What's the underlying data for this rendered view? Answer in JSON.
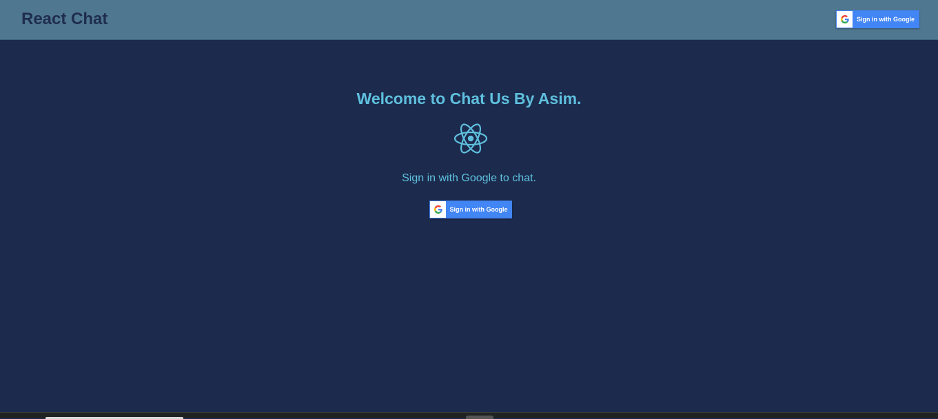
{
  "app": {
    "brand": "React Chat"
  },
  "header": {
    "signin_label": "Sign in with Google"
  },
  "main": {
    "welcome": "Welcome to Chat Us By Asim.",
    "subtitle": "Sign in with Google to chat.",
    "signin_label": "Sign in with Google",
    "logo_icon": "react-logo-icon"
  },
  "colors": {
    "navbar": "#4f778f",
    "background": "#1c2b4d",
    "accent": "#5fc0de",
    "google_blue": "#4285f4"
  }
}
